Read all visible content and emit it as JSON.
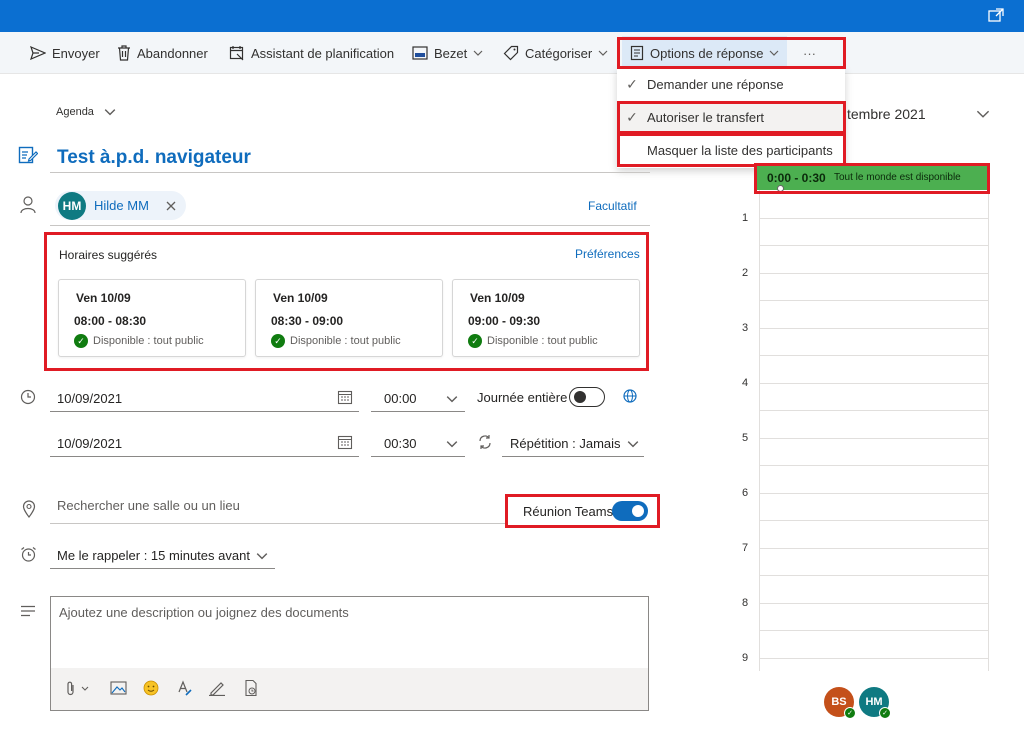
{
  "toolbar": {
    "send": "Envoyer",
    "discard": "Abandonner",
    "scheduling_assistant": "Assistant de planification",
    "busy": "Bezet",
    "categorize": "Catégoriser",
    "response_options": "Options de réponse",
    "more": "···"
  },
  "response_menu": {
    "request_response": "Demander une réponse",
    "allow_forwarding": "Autoriser le transfert",
    "hide_attendees": "Masquer la liste des participants"
  },
  "calendar_select": "Agenda",
  "event": {
    "title": "Test à.p.d. navigateur",
    "attendee_initials": "HM",
    "attendee_name": "Hilde MM",
    "optional_link": "Facultatif"
  },
  "suggested": {
    "heading": "Horaires suggérés",
    "preferences_link": "Préférences",
    "slots": [
      {
        "day": "Ven 10/09",
        "time": "08:00 - 08:30",
        "status": "Disponible : tout public"
      },
      {
        "day": "Ven 10/09",
        "time": "08:30 - 09:00",
        "status": "Disponible : tout public"
      },
      {
        "day": "Ven 10/09",
        "time": "09:00 - 09:30",
        "status": "Disponible : tout public"
      }
    ]
  },
  "start": {
    "date": "10/09/2021",
    "time": "00:00"
  },
  "end": {
    "date": "10/09/2021",
    "time": "00:30"
  },
  "all_day_label": "Journée entière",
  "repeat_label": "Répétition : Jamais",
  "location_placeholder": "Rechercher une salle ou un lieu",
  "teams_label": "Réunion Teams",
  "reminder_label": "Me le rappeler : 15 minutes avant",
  "description_placeholder": "Ajoutez une description ou joignez des documents",
  "calendar_panel": {
    "month_title": "tembre 2021",
    "slot_time": "0:00 - 0:30",
    "slot_status": "Tout le monde est disponible",
    "hours": [
      "1",
      "2",
      "3",
      "4",
      "5",
      "6",
      "7",
      "8",
      "9"
    ],
    "avatar_1": "BS",
    "avatar_2": "HM"
  },
  "colors": {
    "accent": "#0f6cbd",
    "title_bar": "#0b6fd1",
    "highlight_red": "#e01b24",
    "available_green": "#107c10",
    "slot_green": "#4caf50"
  }
}
